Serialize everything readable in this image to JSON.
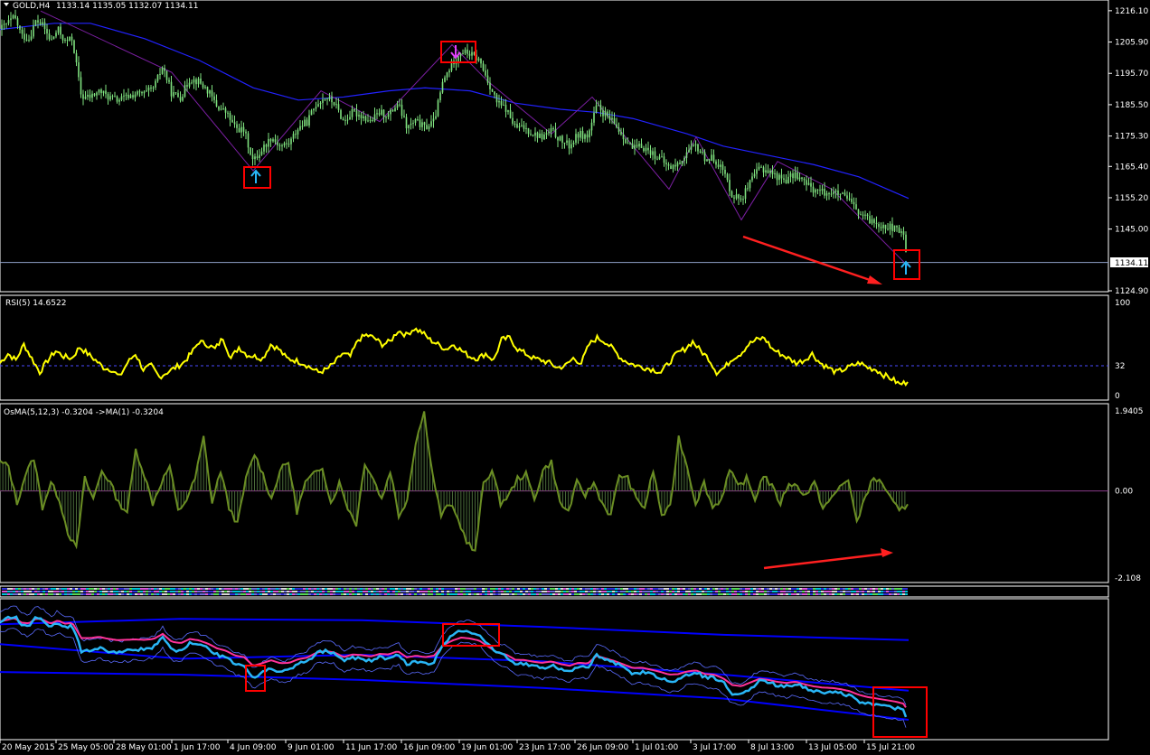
{
  "main_panel": {
    "symbol_line": "GOLD,H4",
    "ohlc": "1133.14 1135.05 1132.07 1134.11",
    "price_tag": "1134.11",
    "y_ticks": [
      "1216.10",
      "1205.90",
      "1195.70",
      "1185.50",
      "1175.30",
      "1165.40",
      "1155.20",
      "1145.00",
      "1124.90"
    ]
  },
  "rsi_panel": {
    "label": "RSI(5) 14.6522",
    "y_ticks": [
      "100",
      "32",
      "0"
    ]
  },
  "osma_panel": {
    "label": "OsMA(5,12,3) -0.3204  ->MA(1) -0.3204",
    "y_ticks": [
      "1.9405",
      "0.00",
      "-2.108"
    ]
  },
  "strip_panel": {
    "label": ""
  },
  "x_axis": {
    "labels": [
      "20 May 2015",
      "25 May 05:00",
      "28 May 01:00",
      "1 Jun 17:00",
      "4 Jun 09:00",
      "9 Jun 01:00",
      "11 Jun 17:00",
      "16 Jun 09:00",
      "19 Jun 01:00",
      "23 Jun 17:00",
      "26 Jun 09:00",
      "1 Jul 01:00",
      "3 Jul 17:00",
      "8 Jul 13:00",
      "13 Jul 05:00",
      "15 Jul 21:00"
    ]
  },
  "colors": {
    "background": "#000000",
    "candles": "#7fe27f",
    "ma": "#2222ff",
    "zigzag": "#7b1fa2",
    "rsi": "#ffff00",
    "osma": "#6b8e23",
    "annotation_box": "#ff0000",
    "bands": "#0000ff",
    "fast_line": "#29b6f6",
    "signal_line": "#ff3399",
    "axis_text": "#ffffff"
  },
  "chart_data": [
    {
      "type": "line",
      "name": "price",
      "x_labels": [
        "20 May 2015",
        "25 May 05:00",
        "28 May 01:00",
        "1 Jun 17:00",
        "4 Jun 09:00",
        "9 Jun 01:00",
        "11 Jun 17:00",
        "16 Jun 09:00",
        "19 Jun 01:00",
        "23 Jun 17:00",
        "26 Jun 09:00",
        "1 Jul 01:00",
        "3 Jul 17:00",
        "8 Jul 13:00",
        "13 Jul 05:00",
        "15 Jul 21:00"
      ],
      "ylim": [
        1124.9,
        1219.0
      ],
      "close_path": [
        [
          0,
          1210
        ],
        [
          8,
          1212
        ],
        [
          16,
          1214
        ],
        [
          24,
          1208
        ],
        [
          32,
          1207
        ],
        [
          40,
          1213
        ],
        [
          48,
          1211
        ],
        [
          56,
          1206
        ],
        [
          64,
          1210
        ],
        [
          72,
          1206
        ],
        [
          80,
          1207
        ],
        [
          90,
          1188
        ],
        [
          100,
          1188
        ],
        [
          110,
          1190
        ],
        [
          120,
          1188
        ],
        [
          130,
          1187
        ],
        [
          140,
          1188
        ],
        [
          150,
          1189
        ],
        [
          160,
          1189
        ],
        [
          170,
          1191
        ],
        [
          180,
          1198
        ],
        [
          190,
          1189
        ],
        [
          200,
          1188
        ],
        [
          210,
          1194
        ],
        [
          220,
          1193
        ],
        [
          230,
          1190
        ],
        [
          240,
          1185
        ],
        [
          250,
          1183
        ],
        [
          260,
          1178
        ],
        [
          270,
          1177
        ],
        [
          280,
          1167
        ],
        [
          290,
          1171
        ],
        [
          300,
          1175
        ],
        [
          310,
          1172
        ],
        [
          320,
          1173
        ],
        [
          330,
          1178
        ],
        [
          340,
          1180
        ],
        [
          350,
          1186
        ],
        [
          360,
          1188
        ],
        [
          370,
          1186
        ],
        [
          380,
          1180
        ],
        [
          390,
          1183
        ],
        [
          400,
          1182
        ],
        [
          410,
          1180
        ],
        [
          420,
          1183
        ],
        [
          430,
          1182
        ],
        [
          440,
          1186
        ],
        [
          450,
          1178
        ],
        [
          460,
          1180
        ],
        [
          470,
          1178
        ],
        [
          480,
          1180
        ],
        [
          490,
          1193
        ],
        [
          500,
          1199
        ],
        [
          510,
          1203
        ],
        [
          520,
          1202
        ],
        [
          530,
          1200
        ],
        [
          540,
          1193
        ],
        [
          550,
          1186
        ],
        [
          560,
          1184
        ],
        [
          570,
          1178
        ],
        [
          580,
          1178
        ],
        [
          590,
          1176
        ],
        [
          600,
          1175
        ],
        [
          610,
          1177
        ],
        [
          620,
          1174
        ],
        [
          630,
          1172
        ],
        [
          640,
          1176
        ],
        [
          650,
          1175
        ],
        [
          660,
          1185
        ],
        [
          670,
          1182
        ],
        [
          680,
          1179
        ],
        [
          690,
          1175
        ],
        [
          700,
          1171
        ],
        [
          710,
          1172
        ],
        [
          720,
          1170
        ],
        [
          730,
          1168
        ],
        [
          740,
          1165
        ],
        [
          750,
          1166
        ],
        [
          760,
          1170
        ],
        [
          770,
          1172
        ],
        [
          780,
          1168
        ],
        [
          790,
          1168
        ],
        [
          800,
          1164
        ],
        [
          810,
          1156
        ],
        [
          820,
          1155
        ],
        [
          830,
          1160
        ],
        [
          840,
          1165
        ],
        [
          850,
          1164
        ],
        [
          860,
          1162
        ],
        [
          870,
          1161
        ],
        [
          880,
          1163
        ],
        [
          890,
          1160
        ],
        [
          900,
          1158
        ],
        [
          910,
          1157
        ],
        [
          920,
          1157
        ],
        [
          930,
          1156
        ],
        [
          940,
          1154
        ],
        [
          950,
          1150
        ],
        [
          960,
          1148
        ],
        [
          970,
          1147
        ],
        [
          980,
          1146
        ],
        [
          990,
          1145
        ],
        [
          1000,
          1143
        ],
        [
          1004,
          1134.11
        ]
      ],
      "ma_path": [
        [
          0,
          1210
        ],
        [
          60,
          1212
        ],
        [
          100,
          1212
        ],
        [
          160,
          1207
        ],
        [
          220,
          1200
        ],
        [
          280,
          1191
        ],
        [
          330,
          1187
        ],
        [
          380,
          1188
        ],
        [
          430,
          1190
        ],
        [
          470,
          1191
        ],
        [
          520,
          1190
        ],
        [
          570,
          1186
        ],
        [
          620,
          1184
        ],
        [
          660,
          1183
        ],
        [
          700,
          1181
        ],
        [
          760,
          1176
        ],
        [
          800,
          1172
        ],
        [
          850,
          1169
        ],
        [
          900,
          1166
        ],
        [
          950,
          1162
        ],
        [
          1005,
          1155
        ]
      ],
      "zigzag_path": [
        [
          45,
          1216
        ],
        [
          190,
          1196
        ],
        [
          280,
          1164
        ],
        [
          355,
          1190
        ],
        [
          420,
          1180
        ],
        [
          500,
          1205
        ],
        [
          540,
          1193
        ],
        [
          610,
          1176
        ],
        [
          655,
          1188
        ],
        [
          740,
          1158
        ],
        [
          770,
          1175
        ],
        [
          820,
          1148
        ],
        [
          860,
          1167
        ],
        [
          920,
          1158
        ],
        [
          1004,
          1133
        ]
      ],
      "annotations": [
        "up arrow near 4 Jun",
        "down arrow near 19 Jun",
        "up arrow at last bar"
      ]
    },
    {
      "type": "line",
      "name": "RSI(5)",
      "ylim": [
        0,
        100
      ],
      "level": 32,
      "values": [
        35,
        45,
        38,
        55,
        40,
        25,
        38,
        48,
        42,
        40,
        52,
        45,
        38,
        30,
        28,
        20,
        35,
        45,
        28,
        32,
        20,
        25,
        30,
        35,
        45,
        58,
        55,
        50,
        62,
        40,
        52,
        44,
        42,
        40,
        55,
        50,
        40,
        38,
        35,
        30,
        25,
        28,
        35,
        45,
        42,
        60,
        65,
        62,
        55,
        58,
        70,
        65,
        72,
        68,
        60,
        55,
        50,
        55,
        48,
        42,
        40,
        45,
        38,
        60,
        62,
        50,
        45,
        40,
        38,
        35,
        30,
        32,
        40,
        35,
        55,
        62,
        58,
        50,
        40,
        35,
        32,
        30,
        28,
        25,
        35,
        45,
        50,
        58,
        48,
        40,
        25,
        30,
        40,
        45,
        55,
        60,
        62,
        50,
        45,
        40,
        35,
        38,
        45,
        35,
        30,
        25,
        28,
        32,
        35,
        30,
        28,
        22,
        18,
        12,
        14.65
      ]
    },
    {
      "type": "bar",
      "name": "OsMA(5,12,3)",
      "ylim": [
        -2.108,
        1.9405
      ],
      "values": [
        0.7,
        0.6,
        -0.3,
        0.4,
        0.8,
        -0.4,
        0.2,
        -0.2,
        -1.0,
        -1.4,
        0.3,
        -0.2,
        0.5,
        0.2,
        -0.3,
        -0.5,
        1.0,
        0.4,
        -0.3,
        0.2,
        0.6,
        -0.5,
        -0.2,
        0.3,
        1.3,
        -0.3,
        0.5,
        -0.4,
        -0.8,
        0.3,
        0.9,
        0.4,
        -0.2,
        0.5,
        0.7,
        -0.5,
        0.2,
        0.4,
        0.6,
        -0.3,
        0.2,
        -0.4,
        -0.8,
        0.7,
        0.3,
        -0.2,
        0.5,
        -0.6,
        -0.2,
        1.2,
        1.9,
        0.4,
        -0.6,
        -0.3,
        -0.7,
        -1.2,
        -1.5,
        0.2,
        0.5,
        -0.3,
        -0.1,
        0.3,
        0.4,
        -0.2,
        0.5,
        0.7,
        -0.3,
        -0.5,
        0.2,
        -0.1,
        0.2,
        -0.3,
        -0.6,
        0.4,
        0.3,
        -0.2,
        -0.4,
        0.5,
        -0.6,
        -0.4,
        1.3,
        0.6,
        -0.3,
        0.2,
        -0.4,
        -0.2,
        0.5,
        0.1,
        0.3,
        -0.2,
        0.4,
        0.1,
        -0.3,
        0.2,
        0.1,
        -0.1,
        0.2,
        -0.4,
        -0.2,
        0.1,
        0.3,
        -0.8,
        -0.1,
        0.3,
        0.2,
        -0.2,
        -0.5,
        -0.3204
      ]
    }
  ]
}
